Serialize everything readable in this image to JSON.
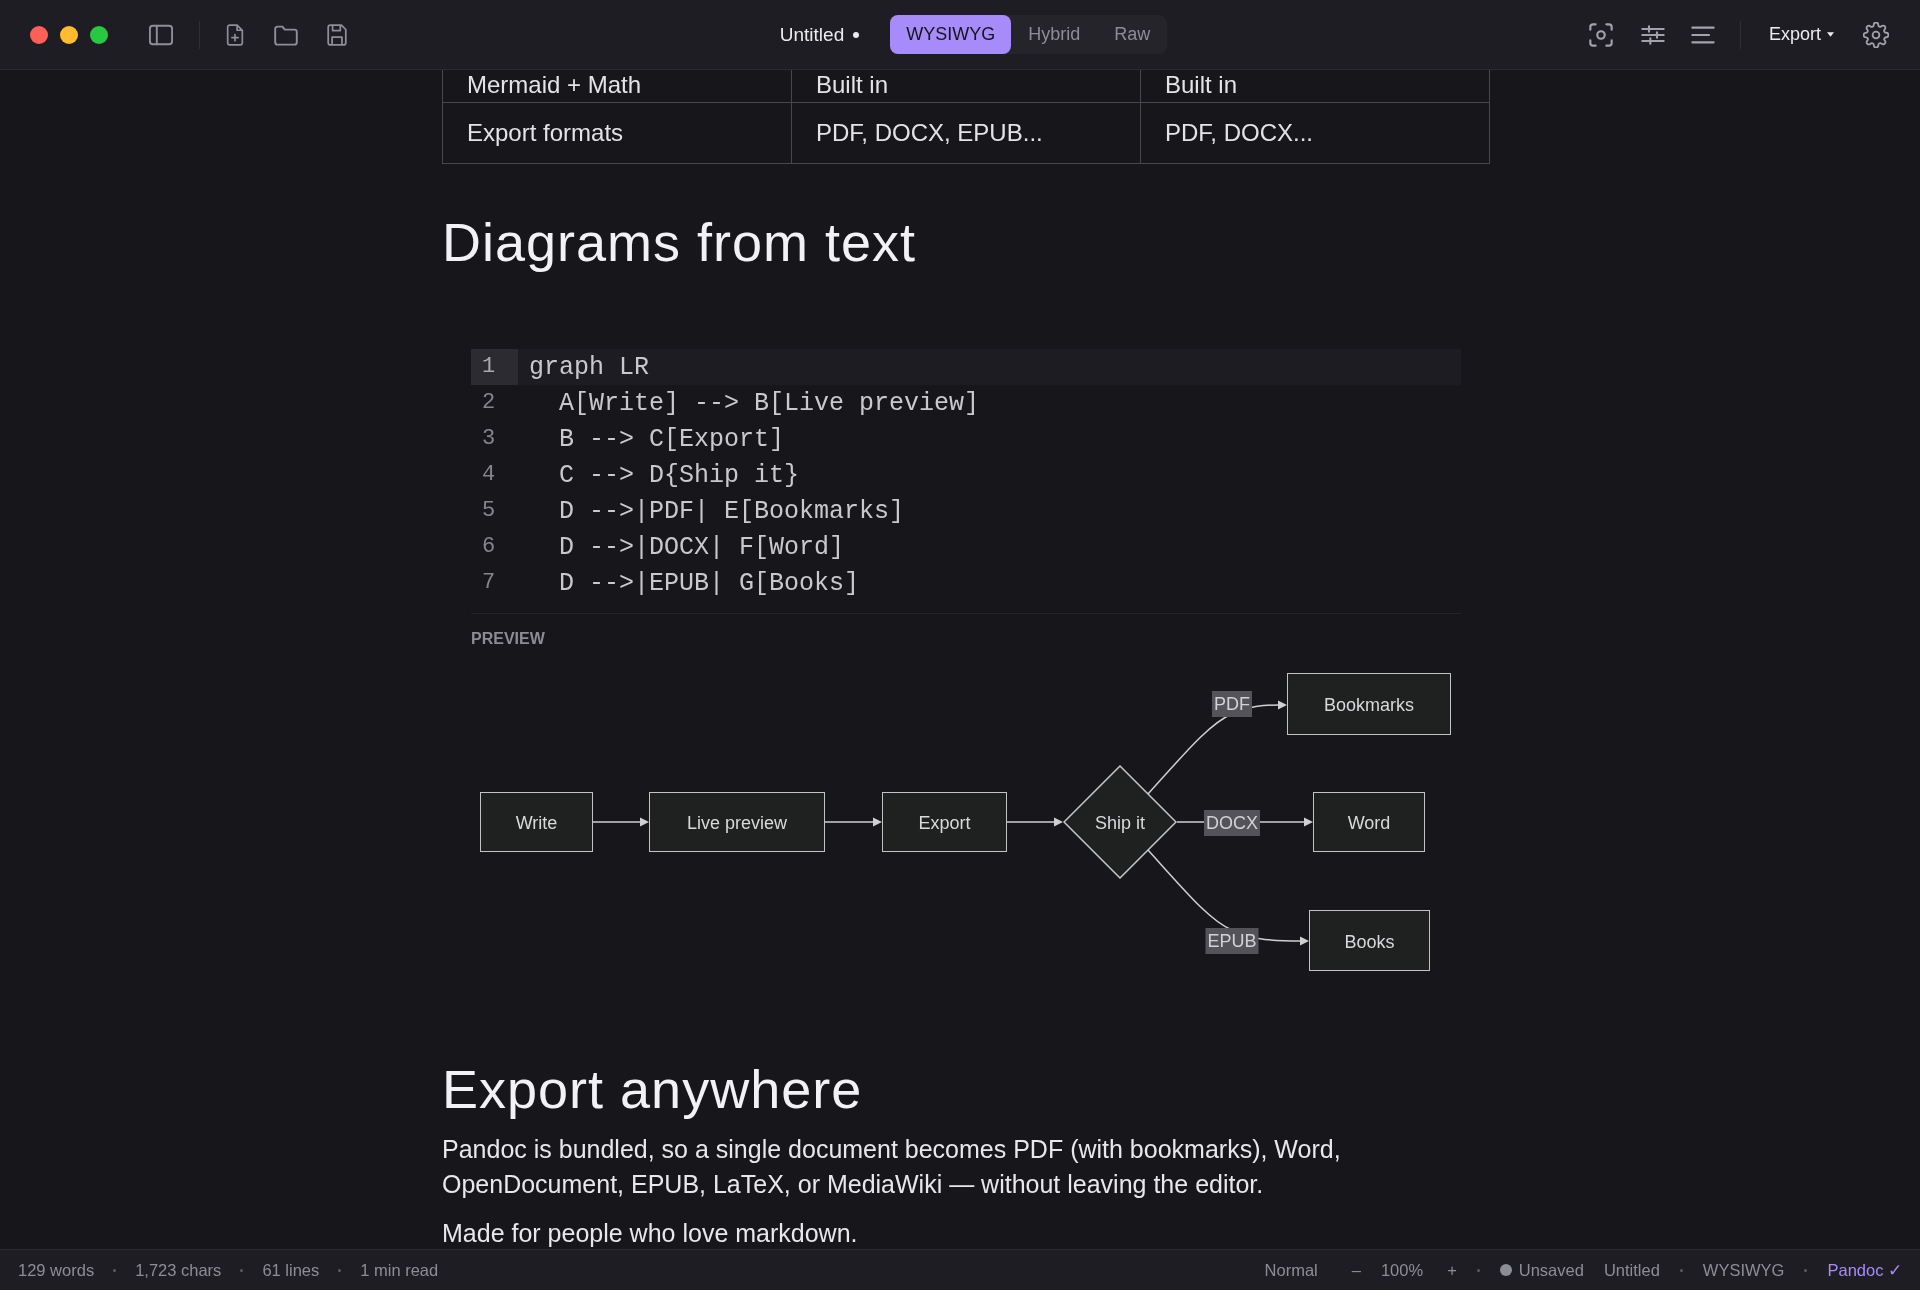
{
  "window": {
    "title": "Untitled",
    "modified": true
  },
  "modes": [
    {
      "label": "WYSIWYG",
      "selected": true
    },
    {
      "label": "Hybrid",
      "selected": false
    },
    {
      "label": "Raw",
      "selected": false
    }
  ],
  "export_menu": {
    "label": "Export"
  },
  "document": {
    "table": {
      "rows": [
        [
          "Mermaid + Math",
          "Built in",
          "Built in"
        ],
        [
          "Export formats",
          "PDF, DOCX, EPUB...",
          "PDF, DOCX..."
        ]
      ]
    },
    "heading_1": "Diagrams from text",
    "code_block": {
      "lines": [
        {
          "number": "1",
          "text": "graph LR",
          "active": true
        },
        {
          "number": "2",
          "text": "  A[Write] --> B[Live preview]",
          "active": false
        },
        {
          "number": "3",
          "text": "  B --> C[Export]",
          "active": false
        },
        {
          "number": "4",
          "text": "  C --> D{Ship it}",
          "active": false
        },
        {
          "number": "5",
          "text": "  D -->|PDF| E[Bookmarks]",
          "active": false
        },
        {
          "number": "6",
          "text": "  D -->|DOCX| F[Word]",
          "active": false
        },
        {
          "number": "7",
          "text": "  D -->|EPUB| G[Books]",
          "active": false
        }
      ],
      "preview_label": "PREVIEW"
    },
    "diagram": {
      "nodes": [
        {
          "label": "Write",
          "kind": "box"
        },
        {
          "label": "Live preview",
          "kind": "box"
        },
        {
          "label": "Export",
          "kind": "box"
        },
        {
          "label": "Ship it",
          "kind": "diamond"
        },
        {
          "label": "Bookmarks",
          "kind": "box"
        },
        {
          "label": "Word",
          "kind": "box"
        },
        {
          "label": "Books",
          "kind": "box"
        }
      ],
      "edge_labels": [
        "PDF",
        "DOCX",
        "EPUB"
      ]
    },
    "heading_2": "Export anywhere",
    "paragraphs": [
      "Pandoc is bundled, so a single document becomes PDF (with bookmarks), Word, OpenDocument, EPUB, LaTeX, or MediaWiki — without leaving the editor.",
      "Made for people who love markdown."
    ]
  },
  "status_bar": {
    "stats": [
      "129 words",
      "1,723 chars",
      "61 lines",
      "1 min read"
    ],
    "style": "Normal",
    "zoom_out": "–",
    "zoom": "100%",
    "zoom_in": "+",
    "save_status": "Unsaved",
    "file": "Untitled",
    "mode": "WYSIWYG",
    "engine": "Pandoc ✓"
  }
}
